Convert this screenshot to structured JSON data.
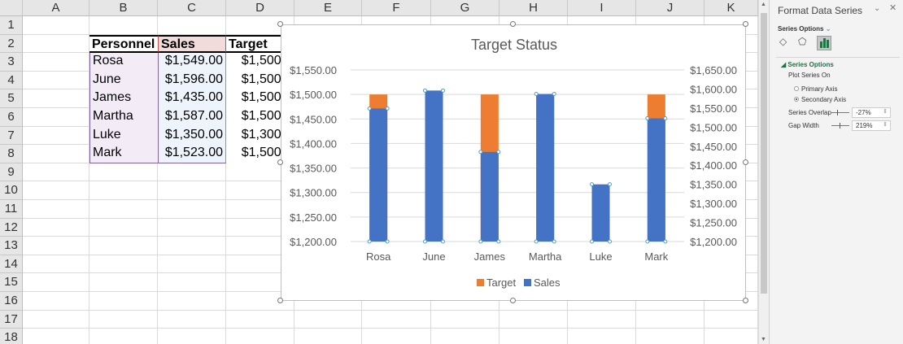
{
  "columns": [
    "A",
    "B",
    "C",
    "D",
    "E",
    "F",
    "G",
    "H",
    "I",
    "J",
    "K"
  ],
  "rows": [
    "1",
    "2",
    "3",
    "4",
    "5",
    "6",
    "7",
    "8",
    "9",
    "10",
    "11",
    "12",
    "13",
    "14",
    "15",
    "16",
    "17",
    "18"
  ],
  "table": {
    "headers": [
      "Personnel",
      "Sales",
      "Target"
    ],
    "rows": [
      [
        "Rosa",
        "$1,549.00",
        "$1,500.0"
      ],
      [
        "June",
        "$1,596.00",
        "$1,500.0"
      ],
      [
        "James",
        "$1,435.00",
        "$1,500.0"
      ],
      [
        "Martha",
        "$1,587.00",
        "$1,500.0"
      ],
      [
        "Luke",
        "$1,350.00",
        "$1,300.0"
      ],
      [
        "Mark",
        "$1,523.00",
        "$1,500.0"
      ]
    ]
  },
  "chart_data": {
    "type": "bar",
    "title": "Target Status",
    "categories": [
      "Rosa",
      "June",
      "James",
      "Martha",
      "Luke",
      "Mark"
    ],
    "series": [
      {
        "name": "Target",
        "axis": "primary",
        "color": "#ed7d31",
        "values": [
          1500,
          1500,
          1500,
          1500,
          1300,
          1500
        ]
      },
      {
        "name": "Sales",
        "axis": "secondary",
        "color": "#4472c4",
        "values": [
          1549,
          1596,
          1435,
          1587,
          1350,
          1523
        ]
      }
    ],
    "primary_axis": {
      "min": 1200,
      "max": 1550,
      "step": 50,
      "ticks": [
        "$1,200.00",
        "$1,250.00",
        "$1,300.00",
        "$1,350.00",
        "$1,400.00",
        "$1,450.00",
        "$1,500.00",
        "$1,550.00"
      ]
    },
    "secondary_axis": {
      "min": 1200,
      "max": 1650,
      "step": 50,
      "ticks": [
        "$1,200.00",
        "$1,250.00",
        "$1,300.00",
        "$1,350.00",
        "$1,400.00",
        "$1,450.00",
        "$1,500.00",
        "$1,550.00",
        "$1,600.00",
        "$1,650.00"
      ]
    },
    "legend": [
      "Target",
      "Sales"
    ],
    "legend_position": "bottom",
    "grid": true
  },
  "pane": {
    "title": "Format Data Series",
    "dropdown": "Series Options",
    "section": "Series Options",
    "plot_on": "Plot Series On",
    "primary": "Primary Axis",
    "secondary": "Secondary Axis",
    "selected": "secondary",
    "overlap_label": "Series Overlap",
    "overlap_value": "-27%",
    "gap_label": "Gap Width",
    "gap_value": "219%"
  }
}
